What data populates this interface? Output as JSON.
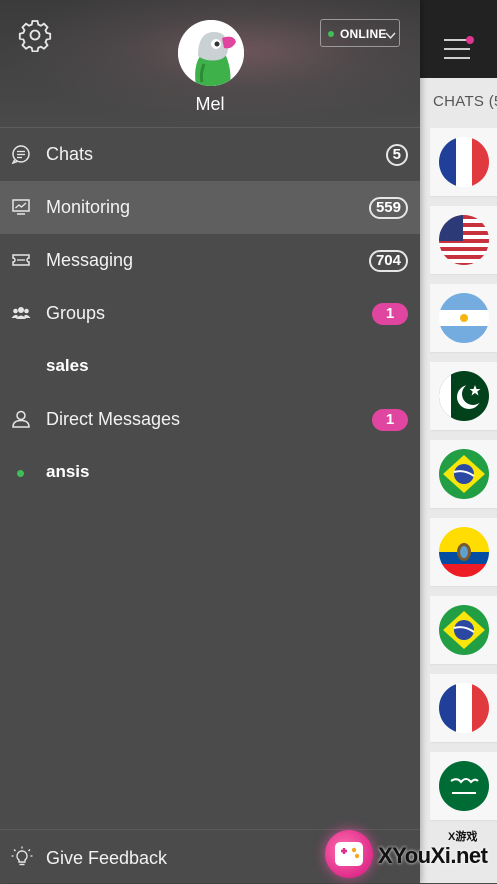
{
  "header": {
    "username": "Mel",
    "status": "ONLINE",
    "icons": {
      "settings": "gear-icon",
      "avatar": "parrot-avatar"
    }
  },
  "nav": {
    "chats": {
      "label": "Chats",
      "count": "5",
      "icon": "chat-bubble-icon"
    },
    "monitoring": {
      "label": "Monitoring",
      "count": "559",
      "icon": "monitor-icon"
    },
    "messaging": {
      "label": "Messaging",
      "count": "704",
      "icon": "ticket-icon"
    },
    "groups": {
      "label": "Groups",
      "count": "1",
      "icon": "group-icon"
    },
    "group_sales": {
      "label": "sales"
    },
    "direct": {
      "label": "Direct Messages",
      "count": "1",
      "icon": "person-icon"
    },
    "direct_ansis": {
      "label": "ansis"
    }
  },
  "footer": {
    "feedback_label": "Give Feedback",
    "icon": "lightbulb-icon"
  },
  "background": {
    "chats_label": "CHATS (5",
    "flags": [
      "france",
      "usa",
      "argentina",
      "pakistan",
      "brazil",
      "ecuador",
      "brazil",
      "france",
      "saudi-arabia"
    ]
  },
  "watermark": {
    "small": "X游戏",
    "big": "XYouXi.net"
  },
  "colors": {
    "badge_pink": "#e0459f",
    "online_green": "#3fbf5a",
    "drawer": "#4b4b4b",
    "active_row": "#5f5f5f"
  }
}
